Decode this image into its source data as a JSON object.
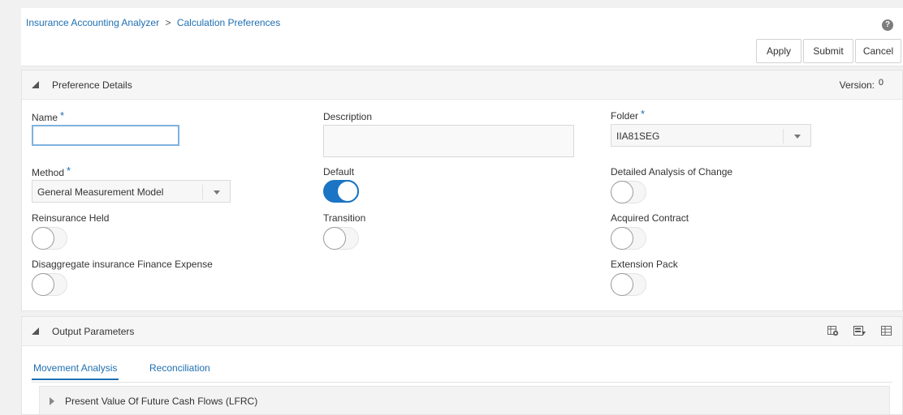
{
  "breadcrumb": {
    "app": "Insurance Accounting Analyzer",
    "separator": ">",
    "page": "Calculation Preferences"
  },
  "help_icon": "?",
  "toolbar": {
    "apply_label": "Apply",
    "submit_label": "Submit",
    "cancel_label": "Cancel"
  },
  "preference_details": {
    "title": "Preference Details",
    "version_label": "Version:",
    "version_value": "0",
    "required_marker": "*",
    "name": {
      "label": "Name",
      "value": ""
    },
    "description": {
      "label": "Description",
      "value": ""
    },
    "folder": {
      "label": "Folder",
      "value": "IIA81SEG"
    },
    "method": {
      "label": "Method",
      "value": "General Measurement Model"
    },
    "toggles": {
      "default": {
        "label": "Default",
        "on": true
      },
      "detailed_analysis": {
        "label": "Detailed Analysis of Change",
        "on": false
      },
      "reinsurance_held": {
        "label": "Reinsurance Held",
        "on": false
      },
      "transition": {
        "label": "Transition",
        "on": false
      },
      "acquired_contract": {
        "label": "Acquired Contract",
        "on": false
      },
      "disaggregate": {
        "label": "Disaggregate insurance Finance Expense",
        "on": false
      },
      "extension_pack": {
        "label": "Extension Pack",
        "on": false
      }
    }
  },
  "output_parameters": {
    "title": "Output Parameters",
    "tools": [
      "settings-table-icon",
      "export-excel-icon",
      "table-view-icon"
    ],
    "tabs": [
      {
        "label": "Movement Analysis",
        "active": true
      },
      {
        "label": "Reconciliation",
        "active": false
      }
    ],
    "accordion_label": "Present Value Of Future Cash Flows (LFRC)"
  },
  "colors": {
    "accent": "#1b74c4",
    "link": "#1f6fb2"
  }
}
